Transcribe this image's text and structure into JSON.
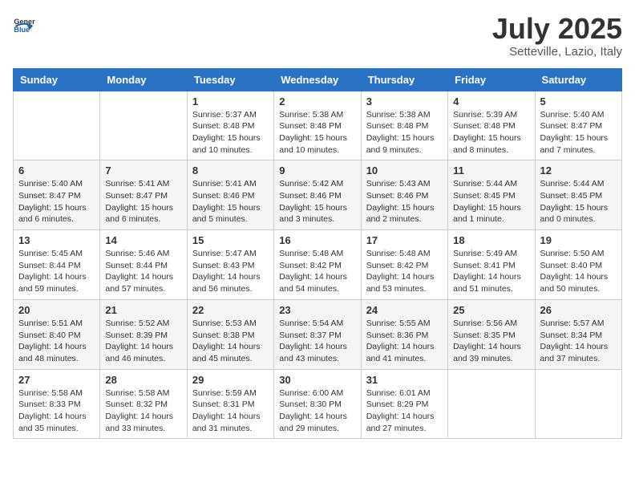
{
  "header": {
    "logo_general": "General",
    "logo_blue": "Blue",
    "month_title": "July 2025",
    "location": "Setteville, Lazio, Italy"
  },
  "days_of_week": [
    "Sunday",
    "Monday",
    "Tuesday",
    "Wednesday",
    "Thursday",
    "Friday",
    "Saturday"
  ],
  "weeks": [
    [
      {
        "day": "",
        "sunrise": "",
        "sunset": "",
        "daylight": ""
      },
      {
        "day": "",
        "sunrise": "",
        "sunset": "",
        "daylight": ""
      },
      {
        "day": "1",
        "sunrise": "Sunrise: 5:37 AM",
        "sunset": "Sunset: 8:48 PM",
        "daylight": "Daylight: 15 hours and 10 minutes."
      },
      {
        "day": "2",
        "sunrise": "Sunrise: 5:38 AM",
        "sunset": "Sunset: 8:48 PM",
        "daylight": "Daylight: 15 hours and 10 minutes."
      },
      {
        "day": "3",
        "sunrise": "Sunrise: 5:38 AM",
        "sunset": "Sunset: 8:48 PM",
        "daylight": "Daylight: 15 hours and 9 minutes."
      },
      {
        "day": "4",
        "sunrise": "Sunrise: 5:39 AM",
        "sunset": "Sunset: 8:48 PM",
        "daylight": "Daylight: 15 hours and 8 minutes."
      },
      {
        "day": "5",
        "sunrise": "Sunrise: 5:40 AM",
        "sunset": "Sunset: 8:47 PM",
        "daylight": "Daylight: 15 hours and 7 minutes."
      }
    ],
    [
      {
        "day": "6",
        "sunrise": "Sunrise: 5:40 AM",
        "sunset": "Sunset: 8:47 PM",
        "daylight": "Daylight: 15 hours and 6 minutes."
      },
      {
        "day": "7",
        "sunrise": "Sunrise: 5:41 AM",
        "sunset": "Sunset: 8:47 PM",
        "daylight": "Daylight: 15 hours and 6 minutes."
      },
      {
        "day": "8",
        "sunrise": "Sunrise: 5:41 AM",
        "sunset": "Sunset: 8:46 PM",
        "daylight": "Daylight: 15 hours and 5 minutes."
      },
      {
        "day": "9",
        "sunrise": "Sunrise: 5:42 AM",
        "sunset": "Sunset: 8:46 PM",
        "daylight": "Daylight: 15 hours and 3 minutes."
      },
      {
        "day": "10",
        "sunrise": "Sunrise: 5:43 AM",
        "sunset": "Sunset: 8:46 PM",
        "daylight": "Daylight: 15 hours and 2 minutes."
      },
      {
        "day": "11",
        "sunrise": "Sunrise: 5:44 AM",
        "sunset": "Sunset: 8:45 PM",
        "daylight": "Daylight: 15 hours and 1 minute."
      },
      {
        "day": "12",
        "sunrise": "Sunrise: 5:44 AM",
        "sunset": "Sunset: 8:45 PM",
        "daylight": "Daylight: 15 hours and 0 minutes."
      }
    ],
    [
      {
        "day": "13",
        "sunrise": "Sunrise: 5:45 AM",
        "sunset": "Sunset: 8:44 PM",
        "daylight": "Daylight: 14 hours and 59 minutes."
      },
      {
        "day": "14",
        "sunrise": "Sunrise: 5:46 AM",
        "sunset": "Sunset: 8:44 PM",
        "daylight": "Daylight: 14 hours and 57 minutes."
      },
      {
        "day": "15",
        "sunrise": "Sunrise: 5:47 AM",
        "sunset": "Sunset: 8:43 PM",
        "daylight": "Daylight: 14 hours and 56 minutes."
      },
      {
        "day": "16",
        "sunrise": "Sunrise: 5:48 AM",
        "sunset": "Sunset: 8:42 PM",
        "daylight": "Daylight: 14 hours and 54 minutes."
      },
      {
        "day": "17",
        "sunrise": "Sunrise: 5:48 AM",
        "sunset": "Sunset: 8:42 PM",
        "daylight": "Daylight: 14 hours and 53 minutes."
      },
      {
        "day": "18",
        "sunrise": "Sunrise: 5:49 AM",
        "sunset": "Sunset: 8:41 PM",
        "daylight": "Daylight: 14 hours and 51 minutes."
      },
      {
        "day": "19",
        "sunrise": "Sunrise: 5:50 AM",
        "sunset": "Sunset: 8:40 PM",
        "daylight": "Daylight: 14 hours and 50 minutes."
      }
    ],
    [
      {
        "day": "20",
        "sunrise": "Sunrise: 5:51 AM",
        "sunset": "Sunset: 8:40 PM",
        "daylight": "Daylight: 14 hours and 48 minutes."
      },
      {
        "day": "21",
        "sunrise": "Sunrise: 5:52 AM",
        "sunset": "Sunset: 8:39 PM",
        "daylight": "Daylight: 14 hours and 46 minutes."
      },
      {
        "day": "22",
        "sunrise": "Sunrise: 5:53 AM",
        "sunset": "Sunset: 8:38 PM",
        "daylight": "Daylight: 14 hours and 45 minutes."
      },
      {
        "day": "23",
        "sunrise": "Sunrise: 5:54 AM",
        "sunset": "Sunset: 8:37 PM",
        "daylight": "Daylight: 14 hours and 43 minutes."
      },
      {
        "day": "24",
        "sunrise": "Sunrise: 5:55 AM",
        "sunset": "Sunset: 8:36 PM",
        "daylight": "Daylight: 14 hours and 41 minutes."
      },
      {
        "day": "25",
        "sunrise": "Sunrise: 5:56 AM",
        "sunset": "Sunset: 8:35 PM",
        "daylight": "Daylight: 14 hours and 39 minutes."
      },
      {
        "day": "26",
        "sunrise": "Sunrise: 5:57 AM",
        "sunset": "Sunset: 8:34 PM",
        "daylight": "Daylight: 14 hours and 37 minutes."
      }
    ],
    [
      {
        "day": "27",
        "sunrise": "Sunrise: 5:58 AM",
        "sunset": "Sunset: 8:33 PM",
        "daylight": "Daylight: 14 hours and 35 minutes."
      },
      {
        "day": "28",
        "sunrise": "Sunrise: 5:58 AM",
        "sunset": "Sunset: 8:32 PM",
        "daylight": "Daylight: 14 hours and 33 minutes."
      },
      {
        "day": "29",
        "sunrise": "Sunrise: 5:59 AM",
        "sunset": "Sunset: 8:31 PM",
        "daylight": "Daylight: 14 hours and 31 minutes."
      },
      {
        "day": "30",
        "sunrise": "Sunrise: 6:00 AM",
        "sunset": "Sunset: 8:30 PM",
        "daylight": "Daylight: 14 hours and 29 minutes."
      },
      {
        "day": "31",
        "sunrise": "Sunrise: 6:01 AM",
        "sunset": "Sunset: 8:29 PM",
        "daylight": "Daylight: 14 hours and 27 minutes."
      },
      {
        "day": "",
        "sunrise": "",
        "sunset": "",
        "daylight": ""
      },
      {
        "day": "",
        "sunrise": "",
        "sunset": "",
        "daylight": ""
      }
    ]
  ]
}
